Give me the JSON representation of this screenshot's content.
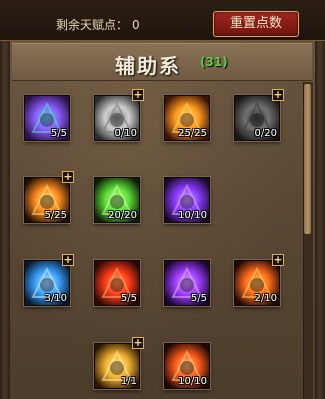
{
  "header": {
    "points_label": "剩余天赋点：",
    "points_value": "0",
    "reset_label": "重置点数"
  },
  "tree": {
    "title": "辅助系",
    "count": "(31)"
  },
  "skills": [
    {
      "id": "eye",
      "level": "5/5",
      "has_plus": false,
      "colors": [
        "#2a1246",
        "#8d5cff",
        "#4fe0c8"
      ]
    },
    {
      "id": "shield",
      "level": "0/10",
      "has_plus": true,
      "colors": [
        "#2b2b2b",
        "#cfcfcf",
        "#7a7a7a"
      ]
    },
    {
      "id": "sun-bull",
      "level": "25/25",
      "has_plus": false,
      "colors": [
        "#3a1406",
        "#ff9a1e",
        "#ffd970"
      ]
    },
    {
      "id": "reaper",
      "level": "0/20",
      "has_plus": true,
      "colors": [
        "#151515",
        "#707070",
        "#3c3c3c"
      ]
    },
    {
      "id": "sword-strike",
      "level": "5/25",
      "has_plus": true,
      "colors": [
        "#1e1006",
        "#ff8a1e",
        "#ffe27a"
      ]
    },
    {
      "id": "green-aura",
      "level": "20/20",
      "has_plus": false,
      "colors": [
        "#0e2008",
        "#5ee03a",
        "#caff9a"
      ]
    },
    {
      "id": "purple-beast",
      "level": "10/10",
      "has_plus": false,
      "colors": [
        "#1a0a30",
        "#8a3cff",
        "#d8a8ff"
      ]
    },
    {
      "id": "blue-wind",
      "level": "3/10",
      "has_plus": true,
      "colors": [
        "#081a30",
        "#3aa0ff",
        "#c8ecff"
      ]
    },
    {
      "id": "fire-pentagram",
      "level": "5/5",
      "has_plus": false,
      "colors": [
        "#2a0804",
        "#ff3a1a",
        "#ffb060"
      ]
    },
    {
      "id": "violet-storm",
      "level": "5/5",
      "has_plus": false,
      "colors": [
        "#180630",
        "#a03cff",
        "#e0b0ff"
      ]
    },
    {
      "id": "flame-figure",
      "level": "2/10",
      "has_plus": true,
      "colors": [
        "#200806",
        "#ff6a1a",
        "#ffcf60"
      ]
    },
    {
      "id": "golden-cross",
      "level": "1/1",
      "has_plus": true,
      "colors": [
        "#2a1604",
        "#f0b030",
        "#fff0a0"
      ]
    },
    {
      "id": "fire-phoenix",
      "level": "10/10",
      "has_plus": false,
      "colors": [
        "#1e0804",
        "#ff5a1a",
        "#ffd080"
      ]
    }
  ]
}
